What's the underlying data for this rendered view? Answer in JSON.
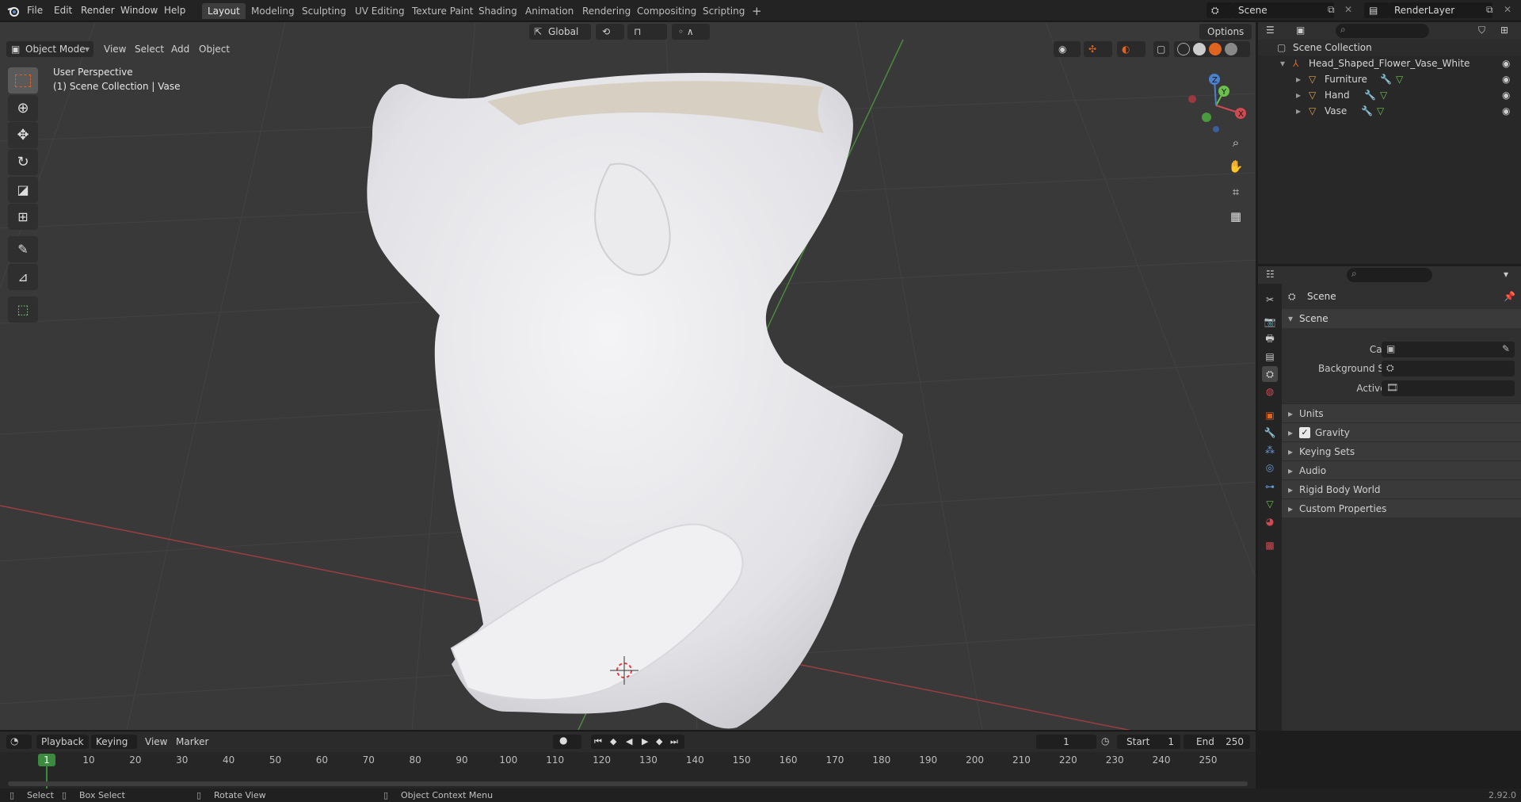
{
  "app": {
    "menu": [
      "File",
      "Edit",
      "Render",
      "Window",
      "Help"
    ],
    "workspace_tabs": [
      "Layout",
      "Modeling",
      "Sculpting",
      "UV Editing",
      "Texture Paint",
      "Shading",
      "Animation",
      "Rendering",
      "Compositing",
      "Scripting"
    ],
    "active_tab": "Layout",
    "scene_name": "Scene",
    "view_layer": "RenderLayer"
  },
  "viewport": {
    "mode": "Object Mode",
    "menus": [
      "View",
      "Select",
      "Add",
      "Object"
    ],
    "transform_orientation": "Global",
    "options_label": "Options",
    "overlay_title": "User Perspective",
    "overlay_subtitle": "(1) Scene Collection | Vase",
    "gizmo_axes": [
      "X",
      "Y",
      "Z"
    ],
    "tools": [
      "select-box",
      "cursor",
      "move",
      "rotate",
      "scale",
      "transform",
      "annotate",
      "measure",
      "add-cube"
    ],
    "accent_color": "#e0641f"
  },
  "outliner": {
    "root": "Scene Collection",
    "collection": "Head_Shaped_Flower_Vase_White",
    "objects": [
      "Furniture",
      "Hand",
      "Vase"
    ]
  },
  "properties": {
    "header_title": "Scene",
    "panel_title": "Scene",
    "fields": [
      {
        "label": "Camera"
      },
      {
        "label": "Background Scene"
      },
      {
        "label": "Active Clip"
      }
    ],
    "subpanels": [
      "Units",
      "Gravity",
      "Keying Sets",
      "Audio",
      "Rigid Body World",
      "Custom Properties"
    ],
    "gravity_checked": true
  },
  "timeline": {
    "menus": [
      "Playback",
      "Keying",
      "View",
      "Marker"
    ],
    "current_frame": "1",
    "start_label": "Start",
    "start": "1",
    "end_label": "End",
    "end": "250",
    "ruler": [
      "1",
      "10",
      "20",
      "30",
      "40",
      "50",
      "60",
      "70",
      "80",
      "90",
      "100",
      "110",
      "120",
      "130",
      "140",
      "150",
      "160",
      "170",
      "180",
      "190",
      "200",
      "210",
      "220",
      "230",
      "240",
      "250"
    ]
  },
  "statusbar": {
    "items": [
      "Select",
      "Box Select",
      "Rotate View",
      "Object Context Menu"
    ],
    "version": "2.92.0"
  }
}
